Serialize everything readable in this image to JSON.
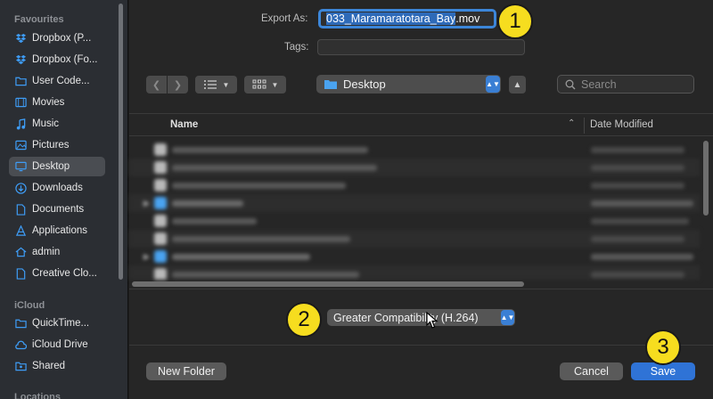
{
  "sidebar": {
    "favourites_title": "Favourites",
    "icloud_title": "iCloud",
    "locations_title": "Locations",
    "favourites": [
      {
        "label": "Dropbox (P...",
        "icon": "dropbox-icon"
      },
      {
        "label": "Dropbox (Fo...",
        "icon": "dropbox-icon"
      },
      {
        "label": "User Code...",
        "icon": "folder-icon"
      },
      {
        "label": "Movies",
        "icon": "film-icon"
      },
      {
        "label": "Music",
        "icon": "music-note-icon"
      },
      {
        "label": "Pictures",
        "icon": "picture-icon"
      },
      {
        "label": "Desktop",
        "icon": "desktop-icon",
        "selected": true
      },
      {
        "label": "Downloads",
        "icon": "download-icon"
      },
      {
        "label": "Documents",
        "icon": "document-icon"
      },
      {
        "label": "Applications",
        "icon": "applications-icon"
      },
      {
        "label": "admin",
        "icon": "home-icon"
      },
      {
        "label": "Creative Clo...",
        "icon": "document-icon"
      }
    ],
    "icloud": [
      {
        "label": "QuickTime...",
        "icon": "folder-icon"
      },
      {
        "label": "iCloud Drive",
        "icon": "cloud-icon"
      },
      {
        "label": "Shared",
        "icon": "shared-folder-icon"
      }
    ]
  },
  "export": {
    "label": "Export As:",
    "filename_selected": "033_Maramaratotara_Bay",
    "filename_ext": ".mov"
  },
  "tags": {
    "label": "Tags:",
    "value": ""
  },
  "toolbar": {
    "location": "Desktop",
    "search_placeholder": "Search"
  },
  "file_list": {
    "col_name": "Name",
    "col_date": "Date Modified"
  },
  "format": {
    "selected": "Greater Compatibility (H.264)"
  },
  "buttons": {
    "new_folder": "New Folder",
    "cancel": "Cancel",
    "save": "Save"
  },
  "callouts": [
    "1",
    "2",
    "3"
  ],
  "colors": {
    "accent": "#2f73d6",
    "callout": "#f6dd1f",
    "sidebar_icon": "#3e9cf5"
  }
}
